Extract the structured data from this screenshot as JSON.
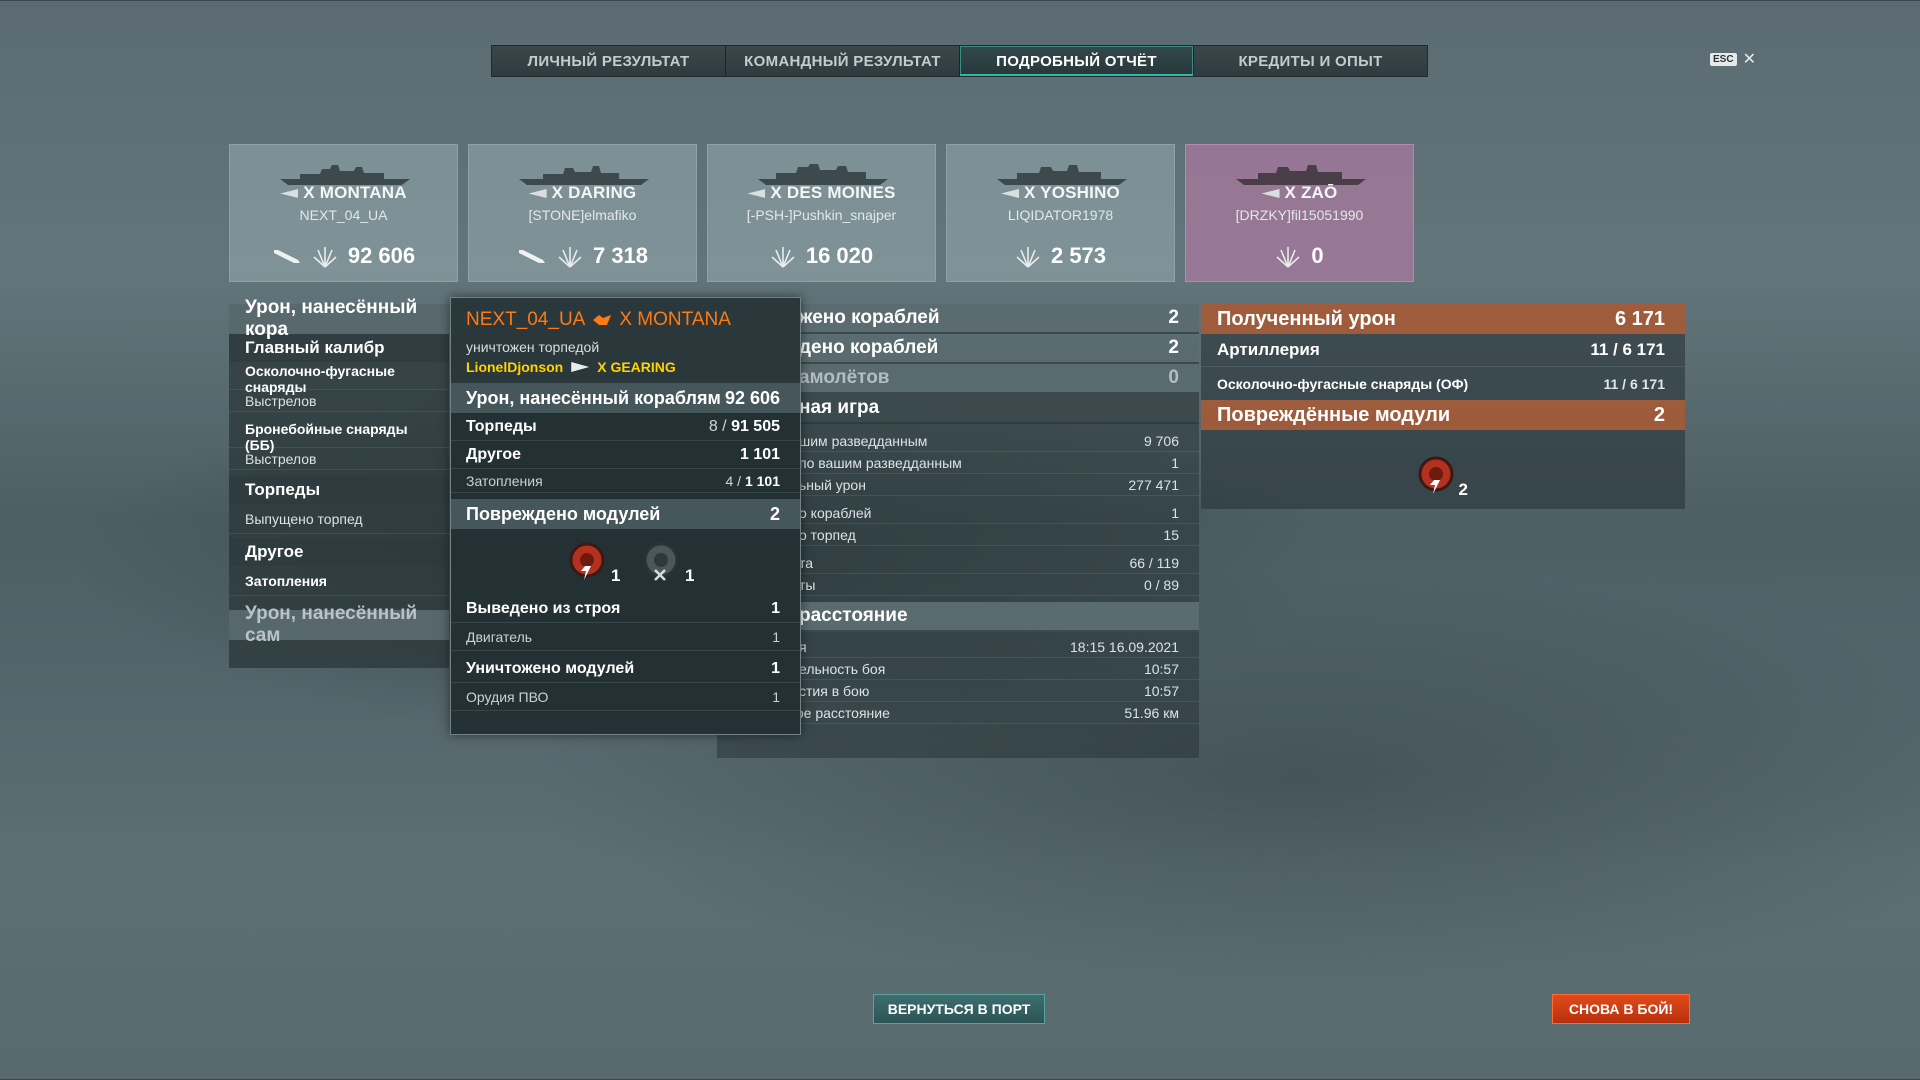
{
  "tabs": [
    {
      "label": "ЛИЧНЫЙ РЕЗУЛЬТАТ"
    },
    {
      "label": "КОМАНДНЫЙ РЕЗУЛЬТАТ"
    },
    {
      "label": "ПОДРОБНЫЙ ОТЧЁТ"
    },
    {
      "label": "КРЕДИТЫ И ОПЫТ"
    }
  ],
  "active_tab": "ПОДРОБНЫЙ ОТЧЁТ",
  "esc": {
    "key": "ESC",
    "close": "✕"
  },
  "ships": [
    {
      "name": "X MONTANA",
      "player": "NEXT_04_UA",
      "damage": "92 606",
      "has_torpedo": true,
      "enemy": false
    },
    {
      "name": "X DARING",
      "player": "[STONE]elmafiko",
      "damage": "7 318",
      "has_torpedo": true,
      "enemy": false
    },
    {
      "name": "X DES MOINES",
      "player": "[-PSH-]Pushkin_snajper",
      "damage": "16 020",
      "has_torpedo": false,
      "enemy": false
    },
    {
      "name": "X YOSHINO",
      "player": "LIQIDATOR1978",
      "damage": "2 573",
      "has_torpedo": false,
      "enemy": false
    },
    {
      "name": "X ZAŌ",
      "player": "[DRZKY]fil15051990",
      "damage": "0",
      "has_torpedo": false,
      "enemy": true
    }
  ],
  "left": {
    "damage_header": "Урон, нанесённый кора",
    "main_battery": "Главный калибр",
    "he_shells": "Осколочно-фугасные снаряды",
    "shots1": "Выстрелов",
    "ap_shells": "Бронебойные снаряды (ББ)",
    "shots2": "Выстрелов",
    "torpedoes": "Торпеды",
    "torpedoes_launched": "Выпущено торпед",
    "other": "Другое",
    "flooding": "Затопления",
    "self_damage_header": "Урон, нанесённый сам"
  },
  "tooltip": {
    "player": "NEXT_04_UA",
    "ship": "X MONTANA",
    "status": "уничтожен торпедой",
    "killer": "LionelDjonson",
    "killer_ship": "X GEARING",
    "damage_label": "Урон, нанесённый кораблям",
    "damage_value": "92 606",
    "torp_label": "Торпеды",
    "torp_hits": "8 / ",
    "torp_damage": "91 505",
    "other_label": "Другое",
    "other_value": "1 101",
    "flood_label": "Затопления",
    "flood_count": "4 / ",
    "flood_damage": "1 101",
    "modules_label": "Повреждено модулей",
    "modules_value": "2",
    "mod1_count": "1",
    "mod2_count": "1",
    "disabled_label": "Выведено из строя",
    "disabled_value": "1",
    "engine_label": "Двигатель",
    "engine_value": "1",
    "destroyed_label": "Уничтожено модулей",
    "destroyed_value": "1",
    "aa_label": "Орудия ПВО",
    "aa_value": "1"
  },
  "middle": {
    "kills_label": "жено кораблей",
    "kills_value": "2",
    "damaged_label": "дено кораблей",
    "damaged_value": "2",
    "planes_label": "амолётов",
    "planes_value": "0",
    "team_label": "ная игра",
    "spot1_label": "шим разведданным",
    "spot1_value": "9 706",
    "spot2_label": "по вашим разведданным",
    "spot2_value": "1",
    "potential_label": "ьный урон",
    "potential_value": "277 471",
    "ships_label": "о кораблей",
    "ships_value": "1",
    "torps_label": "о торпед",
    "torps_value": "15",
    "hits1_label": "та",
    "hits1_value": "66 / 119",
    "hits2_label": "ты",
    "hits2_value": "0 / 89",
    "distance_header": "расстояние",
    "time_label": "я",
    "time_value": "18:15  16.09.2021",
    "duration_label": "ельность боя",
    "duration_value": "10:57",
    "alive_label": "стия в бою",
    "alive_value": "10:57",
    "distance_label": "Пройденное расстояние",
    "distance_value": "51.96 км"
  },
  "right": {
    "received_label": "Полученный урон",
    "received_value": "6 171",
    "artillery_label": "Артиллерия",
    "artillery_hits": "11 / ",
    "artillery_damage": "6 171",
    "he_label": "Осколочно-фугасные снаряды (ОФ)",
    "he_hits": "11 / ",
    "he_damage": "6 171",
    "modules_label": "Повреждённые модули",
    "modules_value": "2",
    "module_count": "2"
  },
  "buttons": {
    "port": "ВЕРНУТЬСЯ В ПОРТ",
    "battle": "СНОВА В БОЙ!"
  },
  "colors": {
    "accent_teal": "#2fb8a8",
    "player_orange": "#ff7a12",
    "killer_yellow": "#ffd200",
    "received_damage_header": "#af5f3a",
    "battle_button": "#d8401a"
  }
}
